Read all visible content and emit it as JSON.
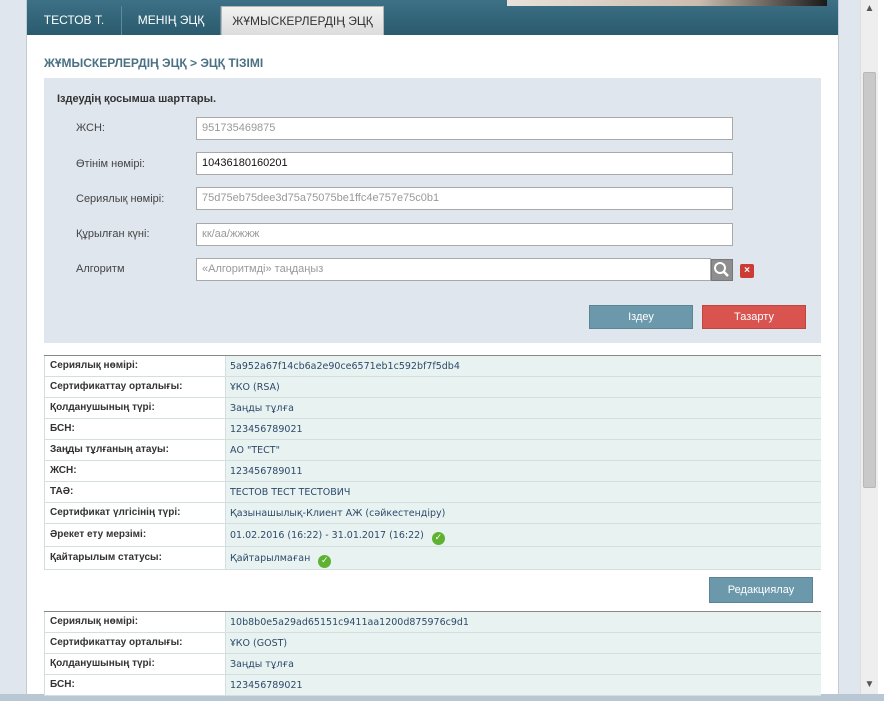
{
  "tabs": [
    {
      "label": "ТЕСТОВ Т."
    },
    {
      "label": "МЕНІҢ ЭЦҚ"
    },
    {
      "label": "ЖҰМЫСКЕРЛЕРДІҢ ЭЦҚ"
    }
  ],
  "breadcrumb": "ЖҰМЫСКЕРЛЕРДІҢ ЭЦҚ > ЭЦҚ ТІЗІМІ",
  "filter": {
    "title": "Іздеудің қосымша шарттары.",
    "fields": [
      {
        "label": "ЖСН:",
        "value": "951735469875"
      },
      {
        "label": "Өтінім нөмірі:",
        "value": "10436180160201"
      },
      {
        "label": "Сериялық нөмірі:",
        "value": "75d75eb75dee3d75a75075be1ffc4e757e75c0b1"
      },
      {
        "label": "Құрылған күні:",
        "value": "кк/аа/жжжж"
      },
      {
        "label": "Алгоритм",
        "value": "«Алгоритмді» таңдаңыз"
      }
    ],
    "search_label": "Іздеу",
    "clear_label": "Тазарту",
    "clear_icon": "×"
  },
  "records": [
    {
      "rows": [
        {
          "label": "Сериялық нөмірі:",
          "value": "5a952a67f14cb6a2e90ce6571eb1c592bf7f5db4"
        },
        {
          "label": "Сертификаттау орталығы:",
          "value": "ҰКО (RSA)"
        },
        {
          "label": "Қолданушының түрі:",
          "value": "Заңды тұлға"
        },
        {
          "label": "БСН:",
          "value": "123456789021"
        },
        {
          "label": "Заңды тұлғаның атауы:",
          "value": "АО \"ТЕСТ\""
        },
        {
          "label": "ЖСН:",
          "value": "123456789011"
        },
        {
          "label": "ТАӘ:",
          "value": "ТЕСТОВ ТЕСТ ТЕСТОВИЧ"
        },
        {
          "label": "Сертификат үлгісінің түрі:",
          "value": "Қазынашылық-Клиент АЖ (сәйкестендіру)"
        },
        {
          "label": "Әрекет ету мерзімі:",
          "value": "01.02.2016 (16:22) - 31.01.2017 (16:22)"
        },
        {
          "label": "Қайтарылым статусы:",
          "value": "Қайтарылмаған"
        }
      ],
      "edit_label": "Редакциялау"
    },
    {
      "rows": [
        {
          "label": "Сериялық нөмірі:",
          "value": "10b8b0e5a29ad65151c9411aa1200d875976c9d1"
        },
        {
          "label": "Сертификаттау орталығы:",
          "value": "ҰКО (GOST)"
        },
        {
          "label": "Қолданушының түрі:",
          "value": "Заңды тұлға"
        },
        {
          "label": "БСН:",
          "value": "123456789021"
        }
      ]
    }
  ],
  "icons": {
    "check": "✓",
    "scroll_up": "▲",
    "scroll_down": "▼"
  },
  "colors": {
    "tab_bar": "#2f6277",
    "accent_button": "#6c98ac",
    "danger_button": "#d9534f",
    "ok": "#5fb231"
  }
}
